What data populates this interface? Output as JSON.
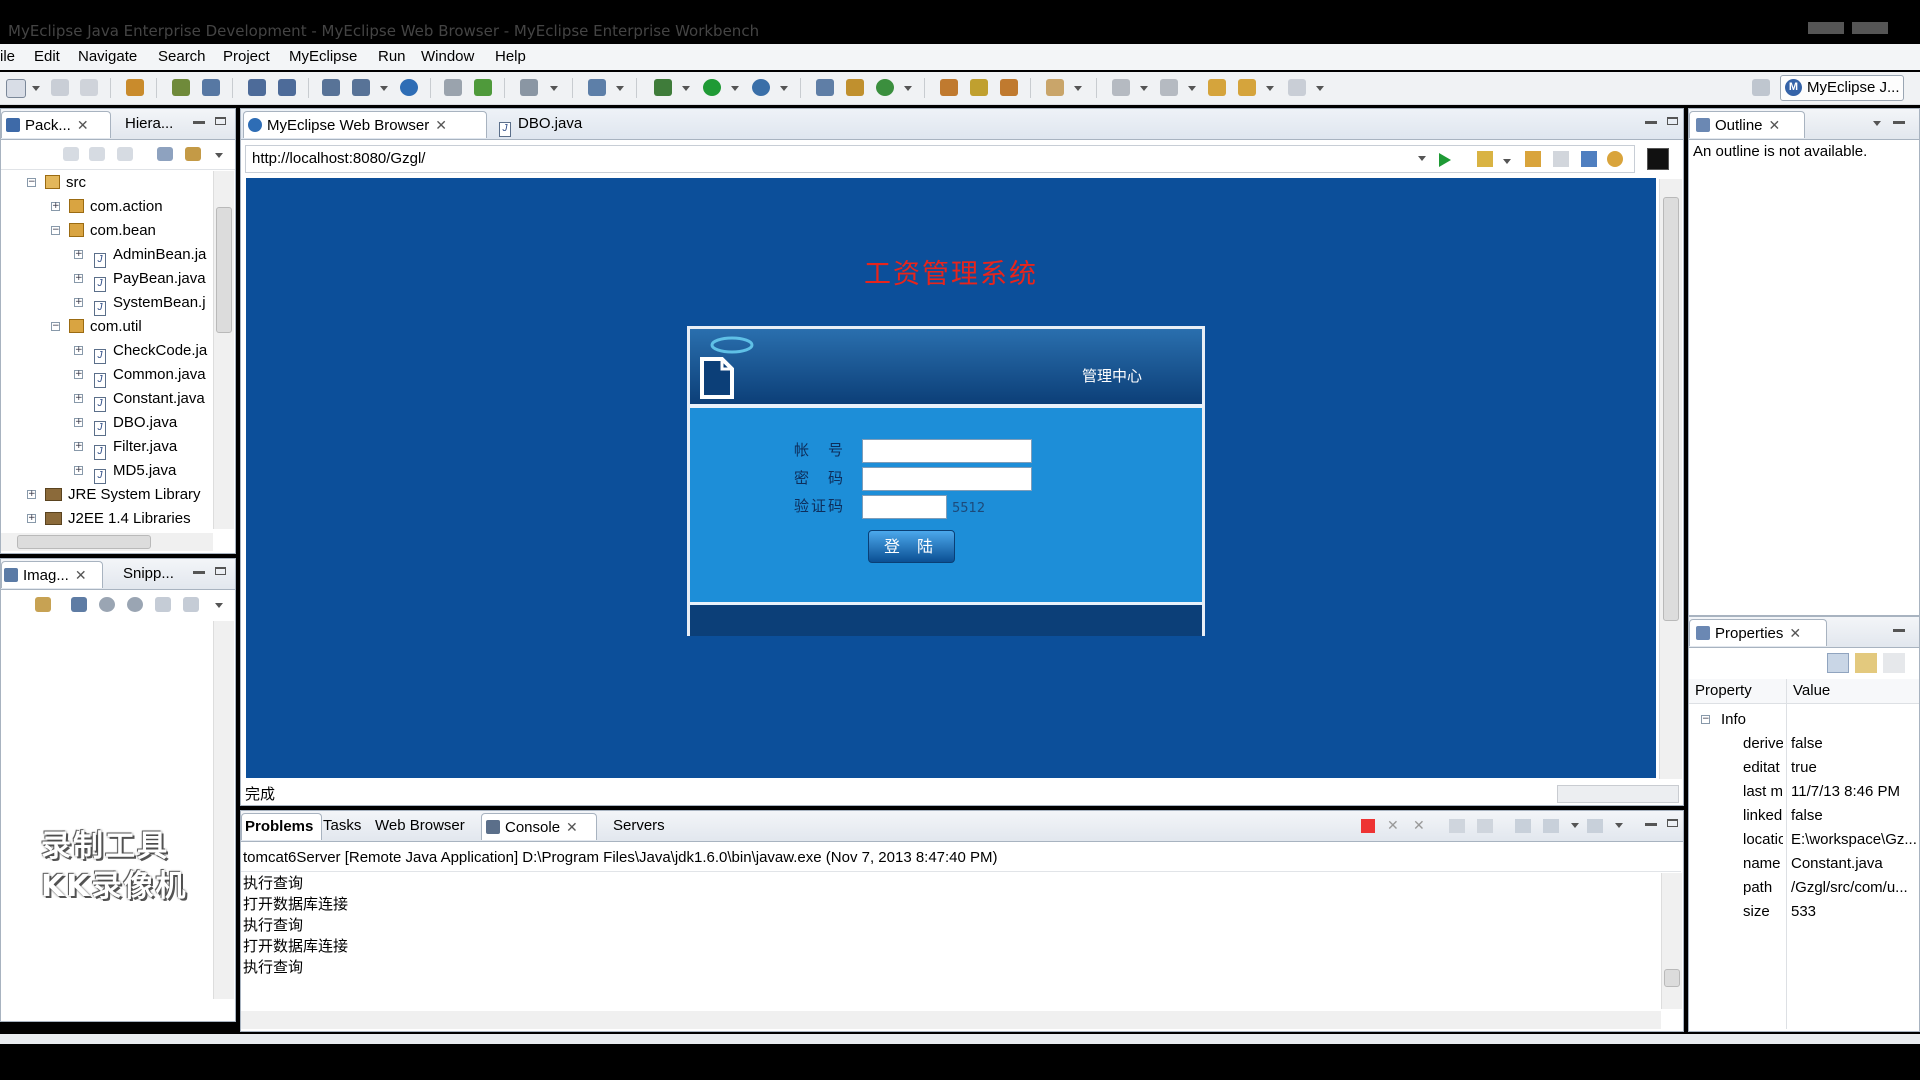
{
  "window": {
    "title": "MyEclipse Java Enterprise Development - MyEclipse Web Browser - MyEclipse Enterprise Workbench"
  },
  "menu": [
    "ile",
    "Edit",
    "Navigate",
    "Search",
    "Project",
    "MyEclipse",
    "Run",
    "Window",
    "Help"
  ],
  "perspective": {
    "label": "MyEclipse J..."
  },
  "left_top_panel": {
    "tabs": [
      "Pack...",
      "Hiera..."
    ],
    "tree": [
      {
        "label": "src",
        "kind": "src",
        "level": 0,
        "expanded": true
      },
      {
        "label": "com.action",
        "kind": "package",
        "level": 1,
        "expanded": false
      },
      {
        "label": "com.bean",
        "kind": "package",
        "level": 1,
        "expanded": true
      },
      {
        "label": "AdminBean.ja",
        "kind": "java",
        "level": 2
      },
      {
        "label": "PayBean.java",
        "kind": "java",
        "level": 2
      },
      {
        "label": "SystemBean.j",
        "kind": "java",
        "level": 2
      },
      {
        "label": "com.util",
        "kind": "package",
        "level": 1,
        "expanded": true
      },
      {
        "label": "CheckCode.ja",
        "kind": "java",
        "level": 2
      },
      {
        "label": "Common.java",
        "kind": "java",
        "level": 2
      },
      {
        "label": "Constant.java",
        "kind": "java",
        "level": 2
      },
      {
        "label": "DBO.java",
        "kind": "java",
        "level": 2
      },
      {
        "label": "Filter.java",
        "kind": "java",
        "level": 2
      },
      {
        "label": "MD5.java",
        "kind": "java",
        "level": 2
      },
      {
        "label": "JRE System Library",
        "kind": "library",
        "level": 0
      },
      {
        "label": "J2EE 1.4 Libraries",
        "kind": "library",
        "level": 0
      }
    ]
  },
  "left_bottom_panel": {
    "tabs": [
      "Imag...",
      "Snipp..."
    ],
    "watermark": [
      "录制工具",
      "KK录像机"
    ]
  },
  "editor": {
    "tabs": [
      {
        "label": "MyEclipse Web Browser",
        "active": true
      },
      {
        "label": "DBO.java",
        "active": false
      }
    ],
    "url": "http://localhost:8080/Gzgl/",
    "status": "完成"
  },
  "web_page": {
    "title": "工资管理系统",
    "header_text": "管理中心",
    "labels": {
      "account": "帐　号",
      "password": "密　码",
      "captcha": "验证码"
    },
    "captcha_code": "5512",
    "login_button": "登 陆"
  },
  "outline": {
    "tab": "Outline",
    "message": "An outline is not available."
  },
  "properties": {
    "tab": "Properties",
    "col_property": "Property",
    "col_value": "Value",
    "group": "Info",
    "rows": [
      {
        "key": "derive",
        "value": "false"
      },
      {
        "key": "editat",
        "value": "true"
      },
      {
        "key": "last m",
        "value": "11/7/13 8:46 PM"
      },
      {
        "key": "linked",
        "value": "false"
      },
      {
        "key": "locatio",
        "value": "E:\\workspace\\Gz..."
      },
      {
        "key": "name",
        "value": "Constant.java"
      },
      {
        "key": "path",
        "value": "/Gzgl/src/com/u..."
      },
      {
        "key": "size",
        "value": "533"
      }
    ]
  },
  "bottom_panel": {
    "tabs": [
      "Problems",
      "Tasks",
      "Web Browser",
      "Console",
      "Servers"
    ],
    "console_header": "tomcat6Server [Remote Java Application] D:\\Program Files\\Java\\jdk1.6.0\\bin\\javaw.exe (Nov 7, 2013 8:47:40 PM)",
    "lines": [
      "执行查询",
      "打开数据库连接",
      "执行查询",
      "打开数据库连接",
      "执行查询"
    ]
  }
}
